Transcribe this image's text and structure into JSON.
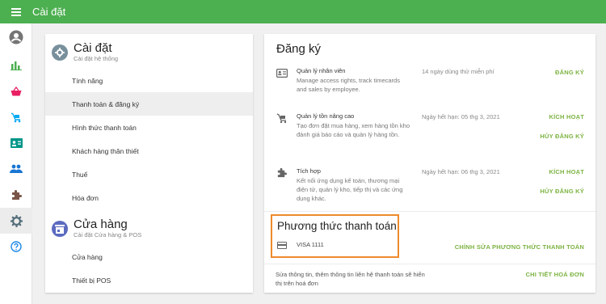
{
  "app": {
    "title": "Cài đặt"
  },
  "rail": [
    "account-circle",
    "bar-chart",
    "shopping-basket",
    "cart",
    "contact-card",
    "people",
    "puzzle",
    "settings",
    "help"
  ],
  "nav": {
    "settings_section": {
      "title": "Cài đặt",
      "subtitle": "Cài đặt hệ thống"
    },
    "settings_items": [
      "Tính năng",
      "Thanh toán & đăng ký",
      "Hình thức thanh toán",
      "Khách hàng thân thiết",
      "Thuế",
      "Hóa đơn"
    ],
    "store_section": {
      "title": "Cửa hàng",
      "subtitle": "Cài đặt Cửa hàng & POS"
    },
    "store_items": [
      "Cửa hàng",
      "Thiết bị POS"
    ]
  },
  "main": {
    "title": "Đăng ký",
    "rows": [
      {
        "icon": "badge-icon",
        "title": "Quản lý nhân viên",
        "desc": "Manage access rights, track timecards and sales by employee.",
        "note": "14 ngày dùng thử miễn phí",
        "actions": [
          "ĐĂNG KÝ"
        ]
      },
      {
        "icon": "cart-icon",
        "title": "Quản lý tồn nâng cao",
        "desc": "Tạo đơn đặt mua hàng, xem hàng tồn kho đánh giá báo cáo và quản lý hàng tồn.",
        "note": "Ngày hết hạn: 05 thg 3, 2021",
        "actions": [
          "KÍCH HOẠT",
          "HỦY ĐĂNG KÝ"
        ]
      },
      {
        "icon": "puzzle-icon",
        "title": "Tích hợp",
        "desc": "Kết nối ứng dụng kế toán, thương mại điện tử, quản lý kho, tiếp thị và các ứng dụng khác.",
        "note": "Ngày hết hạn: 06 thg 3, 2021",
        "actions": [
          "KÍCH HOẠT",
          "HỦY ĐĂNG KÝ"
        ]
      }
    ],
    "payment": {
      "title": "Phương thức thanh toán",
      "card": "VISA 1111",
      "edit_label": "CHỈNH SỬA PHƯƠNG THỨC THANH TOÁN",
      "info": "Sửa thông tin, thêm thông tin liên hệ thanh toán sẽ hiển thị trên hoá đơn",
      "invoice_label": "CHI TIẾT HOÁ ĐƠN"
    }
  },
  "colors": {
    "topbar": "#4caf50",
    "accent": "#7cb342",
    "highlight": "#ee8a2c"
  }
}
